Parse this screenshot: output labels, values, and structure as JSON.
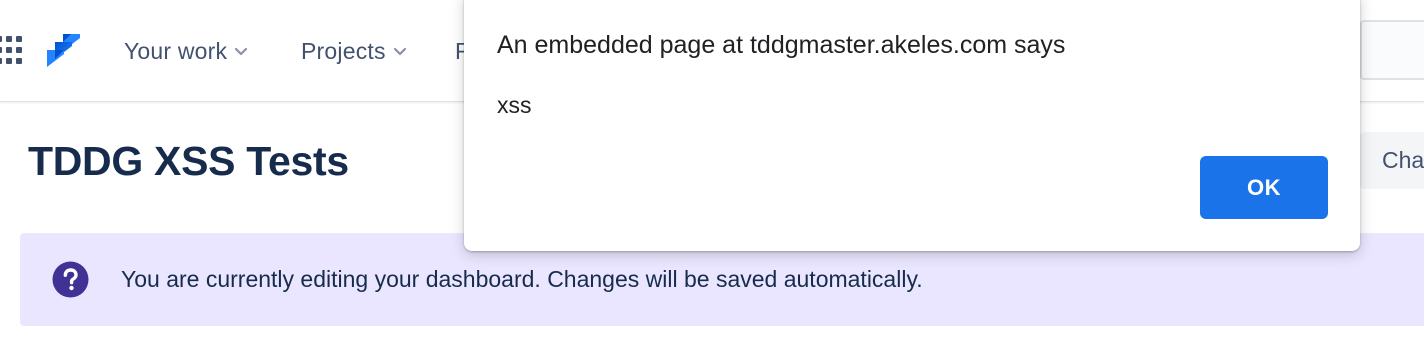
{
  "nav": {
    "items": [
      {
        "label": "Your work",
        "has_dropdown": true
      },
      {
        "label": "Projects",
        "has_dropdown": true
      },
      {
        "label": "F",
        "has_dropdown": false
      }
    ],
    "icons": {
      "app_switcher": "grid-icon",
      "logo": "jira-logo-icon",
      "dropdown": "chevron-down-icon"
    }
  },
  "dashboard": {
    "title": "TDDG XSS Tests",
    "change_button_label": "Cha"
  },
  "banner": {
    "icon": "question-circle-icon",
    "text": "You are currently editing your dashboard. Changes will be saved automatically."
  },
  "dialog": {
    "title": "An embedded page at tddgmaster.akeles.com says",
    "message": "xss",
    "ok_label": "OK"
  },
  "colors": {
    "nav_text": "#42526e",
    "title_text": "#172b4d",
    "jira_blue": "#2684ff",
    "banner_bg": "#eae6ff",
    "banner_icon": "#403294",
    "ok_button_bg": "#1a73e8",
    "divider": "#dfe1e6"
  }
}
